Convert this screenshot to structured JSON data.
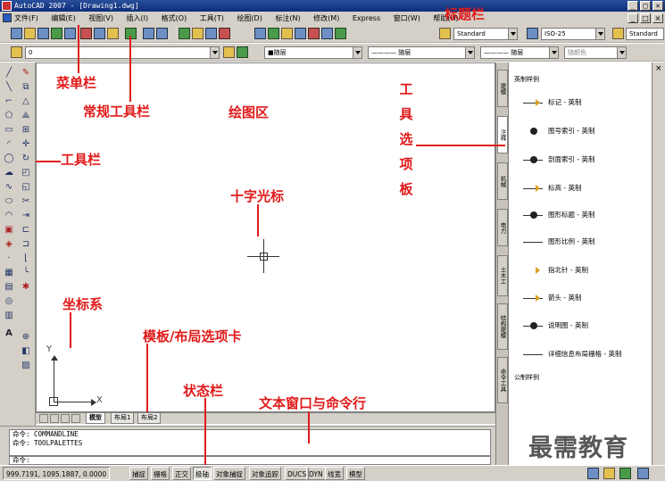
{
  "window": {
    "title": "AutoCAD 2007 - [Drawing1.dwg]",
    "buttons": [
      "_",
      "□",
      "×"
    ]
  },
  "menu": {
    "items": [
      "文件(F)",
      "编辑(E)",
      "视图(V)",
      "插入(I)",
      "格式(O)",
      "工具(T)",
      "绘图(D)",
      "标注(N)",
      "修改(M)",
      "Express",
      "窗口(W)",
      "帮助(H)"
    ]
  },
  "toolbar": {
    "text_style": "Standard",
    "dim_style": "ISO-25",
    "table_style": "Standard",
    "layer": "0",
    "color": "■随层",
    "linetype": "———— 随层",
    "lineweight": "———— 随层",
    "plotstyle": "随颜色"
  },
  "layout_tabs": [
    "模型",
    "布局1",
    "布局2"
  ],
  "command": {
    "history": [
      "命令: COMMANDLINE",
      "命令: TOOLPALETTES"
    ],
    "prompt": "命令:"
  },
  "status": {
    "coords": "999.7191,  1095.1887, 0.0000",
    "buttons": [
      "捕捉",
      "栅格",
      "正交",
      "极轴",
      "对象捕捉",
      "对象追踪",
      "DUCS",
      "DYN",
      "线宽",
      "模型"
    ]
  },
  "palette": {
    "header": "英制样例",
    "footer": "公制样例",
    "tabs": [
      "建模",
      "注释",
      "机械",
      "电力",
      "土木工",
      "结构建模",
      "命令工具"
    ],
    "items": [
      "标记 - 英制",
      "图号索引 - 英制",
      "剖面索引 - 英制",
      "标高 - 英制",
      "图形标题 - 英制",
      "图形比例 - 英制",
      "指北针 - 英制",
      "箭头 - 英制",
      "说明图 - 英制",
      "详细信息布局栅格 - 英制"
    ]
  },
  "ucs": {
    "x": "X",
    "y": "Y"
  },
  "annotations": {
    "title_bar": "标题栏",
    "menu_bar": "菜单栏",
    "standard_toolbar": "常规工具栏",
    "drawing_area": "绘图区",
    "tool_palette": "工具选项板",
    "toolbar": "工具栏",
    "crosshair": "十字光标",
    "coordinate_system": "坐标系",
    "layout_tabs": "模板/布局选项卡",
    "status_bar": "状态栏",
    "command_window": "文本窗口与命令行"
  },
  "watermark": "最需教育",
  "colors": {
    "annotation": "#e01a1a",
    "titlebar": "#0e2d7a",
    "chrome": "#d4d0c8"
  },
  "icons": [
    "autocad-app-icon",
    "document-icon",
    "crosshair-cursor",
    "ucs-icon",
    "palette-close-icon"
  ]
}
